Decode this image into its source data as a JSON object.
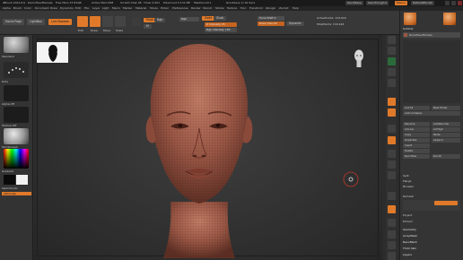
{
  "titlebar": {
    "app_title": "ZBrush 2021.6.6 · DemoHeadFemale",
    "stats": [
      "Free Mem 27.87GB",
      "Active Mem 848",
      "Scratch Disk 48",
      "Timer 0.001",
      "PolyCount 0.131 MP",
      "MeshCount 1"
    ],
    "quicksave": "QuickSave",
    "see_through": "See-through 0",
    "menus_btn": "Menus",
    "default_script": "DefaultZScript"
  },
  "menubar": {
    "items": [
      "Alpha",
      "Brush",
      "Color",
      "Document",
      "Draw",
      "Dynamics",
      "Edit",
      "File",
      "Layer",
      "Light",
      "Macro",
      "Marker",
      "Material",
      "Movie",
      "Picker",
      "Preferences",
      "Render",
      "Stencil",
      "Stroke",
      "Texture",
      "Tool",
      "Transform",
      "Zplugin",
      "Zscript",
      "Help"
    ]
  },
  "toolbar": {
    "home_page": "Home Page",
    "lightbox": "LightBox",
    "live_boolean": "Live Boolean",
    "edit_label": "Edit",
    "draw_label": "Draw",
    "move_label": "Move",
    "scale_label": "Scale",
    "rotate_label": "Rotate",
    "mrgb": "Mrgb",
    "rgb": "Rgb",
    "m": "M",
    "zadd": "Zadd",
    "zsub": "Zsub",
    "zcut": "Zcut",
    "rgb_intensity": "Rgb Intensity 100",
    "z_intensity": "Z Intensity 25",
    "focal_shift": "Focal Shift 0",
    "draw_size": "Draw Size 64",
    "dynamic": "Dynamic",
    "active_points": "ActivePoints: 134,916",
    "total_points": "TotalPoints: 134,916"
  },
  "leftshelf": {
    "items": [
      {
        "label": "Standard"
      },
      {
        "label": "Dots"
      },
      {
        "label": "Alpha Off"
      },
      {
        "label": "Texture Off"
      },
      {
        "label": "SkinShade4"
      },
      {
        "label": "Gradient"
      },
      {
        "label": "SwitchColor"
      },
      {
        "label": "Alternate"
      }
    ]
  },
  "viewport": {
    "zoom_hint": "Floor"
  },
  "rtools": {
    "labels": [
      "BPR",
      "SPix 3",
      "Scroll",
      "Zoom",
      "Actual",
      "AAHalf",
      "Persp",
      "Floor",
      "Local",
      "Frame",
      "Move",
      "Scale",
      "Rotate",
      "Line Fill",
      "PolyF",
      "Transp",
      "Ghost",
      "Solo",
      "Xpose"
    ]
  },
  "rpanel": {
    "subtool_header": "Subtool",
    "subtool_name": "DemoHeadFemale",
    "list_all": "List All",
    "new_folder": "New Folder",
    "auto_collapse": "Auto Collapse",
    "rename": "Rename",
    "all_low": "All Low",
    "all_high": "All High",
    "copy": "Copy",
    "paste": "Paste",
    "duplicate": "Duplicate",
    "append": "Append",
    "insert": "Insert",
    "delete": "Delete",
    "del_other": "Del Other",
    "del_all": "Del All",
    "split": "Split",
    "merge": "Merge",
    "boolean": "Boolean",
    "remesh": "Remesh",
    "project": "Project",
    "extract": "Extract",
    "geometry": "Geometry",
    "arraymesh": "ArrayMesh",
    "nanomesh": "NanoMesh",
    "thick_skin": "Thick Skin",
    "layers": "Layers"
  }
}
